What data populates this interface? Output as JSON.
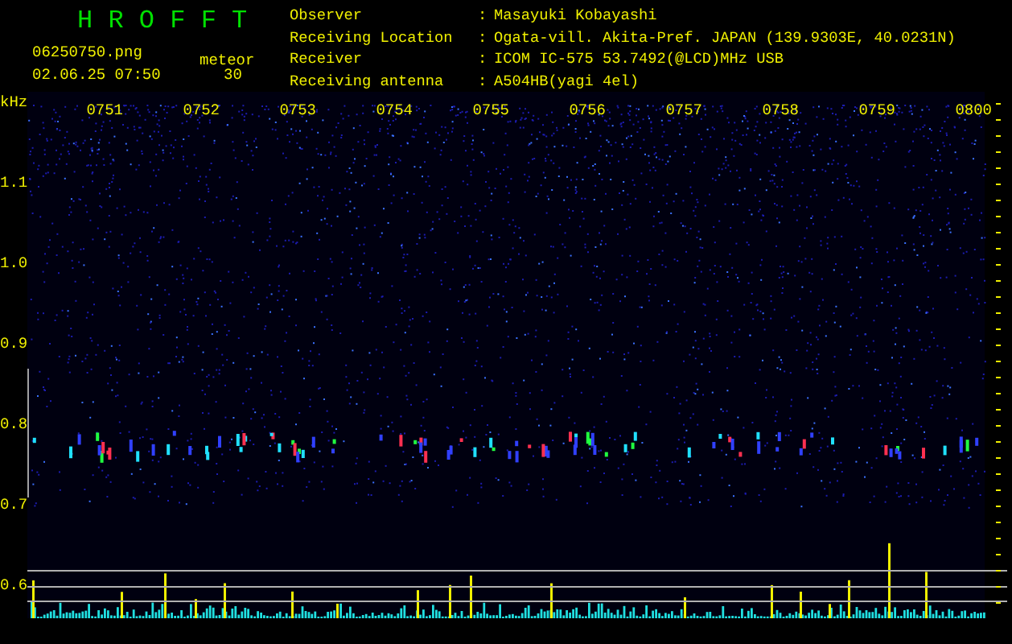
{
  "app": {
    "title": "H R O F F T"
  },
  "file": {
    "name": "06250750.png",
    "datetime": "02.06.25 07:50"
  },
  "counter": {
    "label": "meteor",
    "value": "30"
  },
  "station": [
    {
      "label": "Observer",
      "separator": ":",
      "value": "Masayuki Kobayashi"
    },
    {
      "label": "Receiving Location",
      "separator": ":",
      "value": "Ogata-vill. Akita-Pref. JAPAN (139.9303E, 40.0231N)"
    },
    {
      "label": "Receiver",
      "separator": ":",
      "value": "ICOM IC-575 53.7492(@LCD)MHz USB"
    },
    {
      "label": "Receiving antenna",
      "separator": ":",
      "value": "A504HB(yagi 4el)"
    }
  ],
  "spectrogram": {
    "unit": "kHz",
    "y_labels": [
      "1.1",
      "1.0",
      "0.9",
      "0.8",
      "0.7",
      "0.6"
    ],
    "time_labels": [
      "0751",
      "0752",
      "0753",
      "0754",
      "0755",
      "0756",
      "0757",
      "0758",
      "0759",
      "0800"
    ]
  }
}
